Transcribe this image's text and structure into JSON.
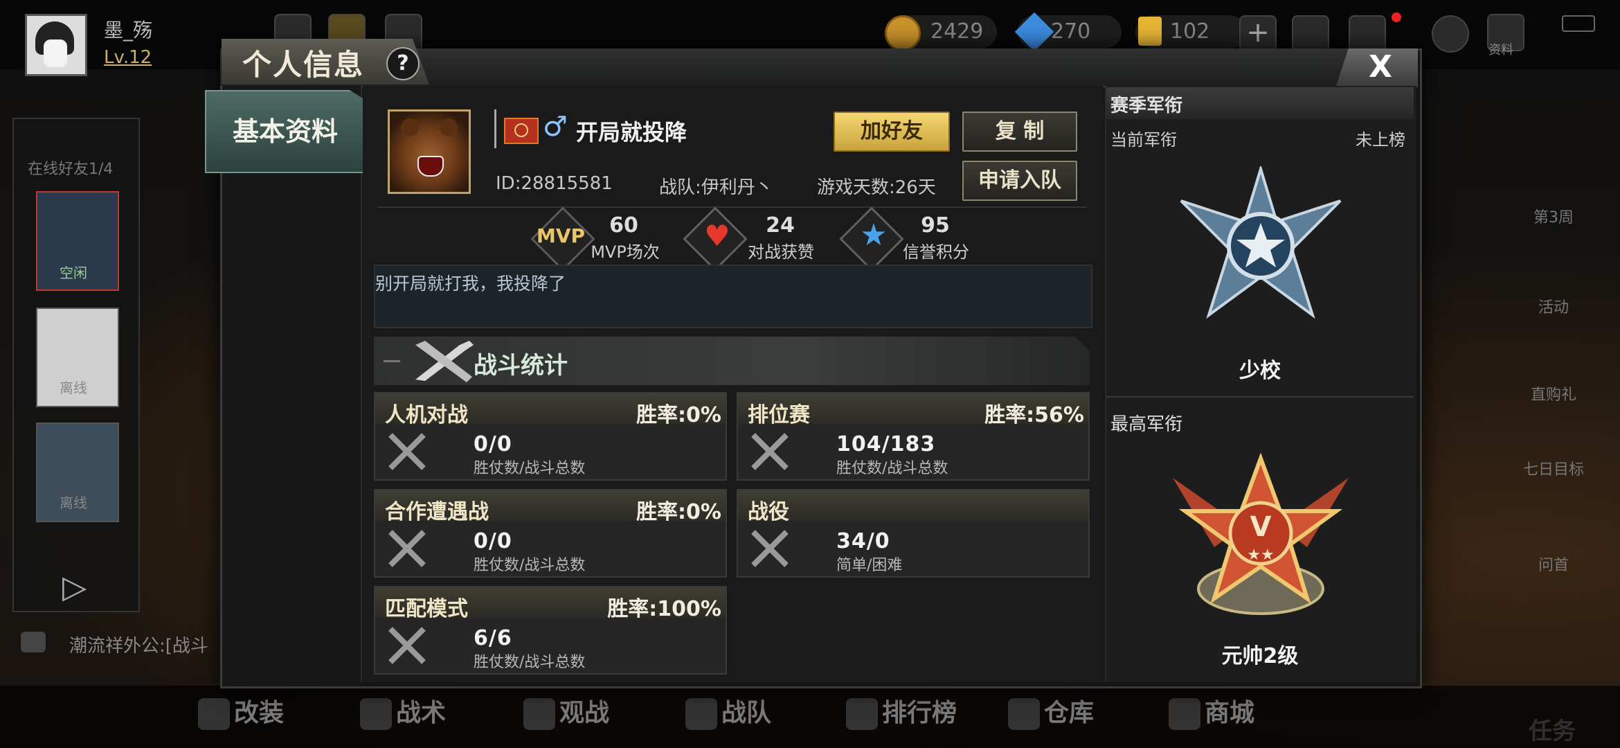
{
  "player": {
    "name": "墨_殇",
    "level": "Lv.12"
  },
  "currencies": {
    "coins": "2429",
    "diamonds": "270",
    "cards": "102"
  },
  "top_right": {
    "archive_label": "资料"
  },
  "left_panel": {
    "online_friends": "在线好友1/4",
    "status_idle": "空闲",
    "status_offline1": "离线",
    "status_offline2": "离线"
  },
  "chat_ticker": "潮流祥外公:[战斗",
  "right_side": [
    "第3周",
    "活动",
    "直购礼",
    "七日目标",
    "问首",
    "任务"
  ],
  "bottom_nav": [
    "改装",
    "战术",
    "观战",
    "战队",
    "排行榜",
    "仓库",
    "商城"
  ],
  "dialog": {
    "title": "个人信息",
    "help": "?",
    "close": "X",
    "tab_basic": "基本资料",
    "profile": {
      "gender_symbol": "♂",
      "username": "开局就投降",
      "id": "ID:28815581",
      "team": "战队:伊利丹丶",
      "days": "游戏天数:26天",
      "signature": "别开局就打我，我投降了"
    },
    "buttons": {
      "add_friend": "加好友",
      "copy": "复 制",
      "join_team": "申请入队"
    },
    "stats": [
      {
        "icon": "mvp-icon",
        "icon_text": "MVP",
        "value": "60",
        "label": "MVP场次"
      },
      {
        "icon": "heart-icon",
        "value": "24",
        "label": "对战获赞"
      },
      {
        "icon": "star-icon",
        "value": "95",
        "label": "信誉积分"
      }
    ],
    "battle_section_title": "战斗统计",
    "battle_boxes": [
      {
        "title": "人机对战",
        "rate": "胜率:0%",
        "value": "0/0",
        "sub": "胜仗数/战斗总数"
      },
      {
        "title": "排位赛",
        "rate": "胜率:56%",
        "value": "104/183",
        "sub": "胜仗数/战斗总数"
      },
      {
        "title": "合作遭遇战",
        "rate": "胜率:0%",
        "value": "0/0",
        "sub": "胜仗数/战斗总数"
      },
      {
        "title": "战役",
        "rate": "",
        "value": "34/0",
        "sub": "简单/困难"
      },
      {
        "title": "匹配模式",
        "rate": "胜率:100%",
        "value": "6/6",
        "sub": "胜仗数/战斗总数"
      }
    ],
    "rank": {
      "season_title": "赛季军衔",
      "current_label": "当前军衔",
      "current_status": "未上榜",
      "current_rank": "少校",
      "highest_title": "最高军衔",
      "highest_rank": "元帅2级"
    }
  },
  "colors": {
    "accent_gold": "#f5d775",
    "tab_teal": "#4d6a64",
    "heart_red": "#e4392b",
    "star_blue": "#4aa3e8"
  }
}
